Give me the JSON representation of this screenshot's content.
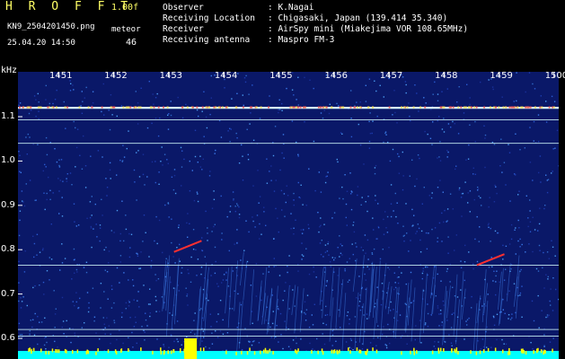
{
  "header": {
    "title": "H R O F F T",
    "version": "1.00f",
    "filename": "KN9_2504201450.png",
    "meteor_label": "meteor",
    "timestamp": "25.04.20 14:50",
    "meteor_count": "46",
    "info": [
      {
        "key": "Observer",
        "value": ": K.Nagai"
      },
      {
        "key": "Receiving Location",
        "value": ": Chigasaki, Japan (139.414 35.340)"
      },
      {
        "key": "Receiver",
        "value": ": AirSpy mini (Miakejima VOR 108.65MHz)"
      },
      {
        "key": "Receiving antenna",
        "value": ": Maspro FM-3"
      }
    ]
  },
  "axes": {
    "unit": "kHz",
    "y_ticks": [
      "1.1",
      "1.0",
      "0.9",
      "0.8",
      "0.7",
      "0.6"
    ],
    "x_ticks": [
      "1451",
      "1452",
      "1453",
      "1454",
      "1455",
      "1456",
      "1457",
      "1458",
      "1459",
      "1500"
    ]
  },
  "colors": {
    "background": "#000000",
    "spectrogram_bg": "#0a1868",
    "header_text": "#ffffff",
    "accent_text": "#ffff66",
    "info_text": "#9ffcff",
    "carrier_line": "#d8ffff",
    "noise_floor": "#00ffff",
    "meteor_echo": "#ff3030",
    "burst": "#ffff00"
  },
  "spectrogram": {
    "carrier_freqs_khz": [
      1.12,
      1.093,
      1.04,
      0.765,
      0.62,
      0.605
    ],
    "strong_carrier_khz": 1.12,
    "meteor_echoes": [
      {
        "t_start": 1453.1,
        "t_end": 1453.6,
        "f_start": 0.795,
        "f_end": 0.82
      },
      {
        "t_start": 1458.6,
        "t_end": 1459.1,
        "f_start": 0.765,
        "f_end": 0.79
      }
    ],
    "burst_time": 1453.4
  }
}
